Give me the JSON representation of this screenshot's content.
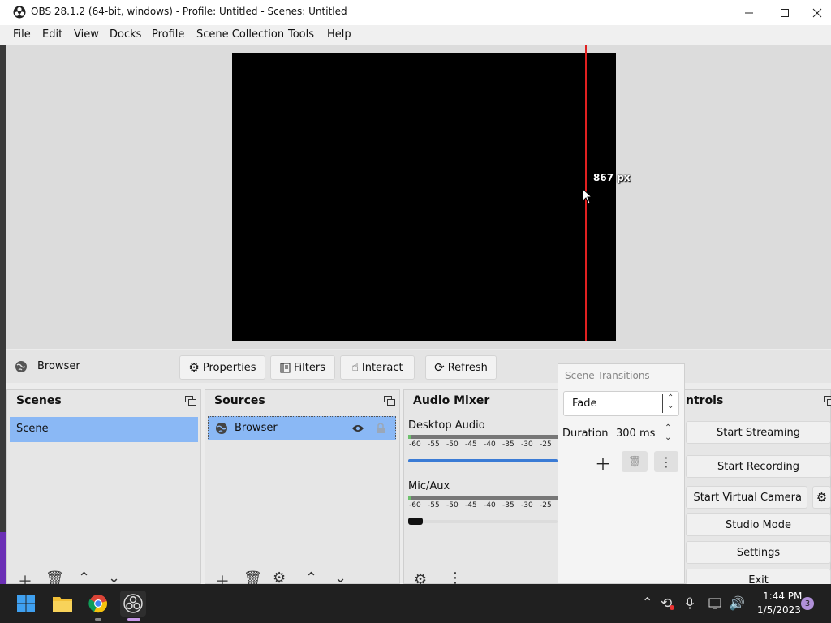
{
  "window": {
    "title": "OBS 28.1.2 (64-bit, windows) - Profile: Untitled - Scenes: Untitled"
  },
  "menu": [
    "File",
    "Edit",
    "View",
    "Docks",
    "Profile",
    "Scene Collection",
    "Tools",
    "Help"
  ],
  "preview": {
    "measure_label": "867 px"
  },
  "context_bar": {
    "source_name": "Browser",
    "properties": "Properties",
    "filters": "Filters",
    "interact": "Interact",
    "refresh": "Refresh"
  },
  "scenes": {
    "title": "Scenes",
    "items": [
      "Scene"
    ]
  },
  "sources": {
    "title": "Sources",
    "items": [
      "Browser"
    ]
  },
  "audio_mixer": {
    "title": "Audio Mixer",
    "channels": [
      {
        "name": "Desktop Audio",
        "scale": [
          "-60",
          "-55",
          "-50",
          "-45",
          "-40",
          "-35",
          "-30",
          "-25"
        ],
        "volume": 1.0
      },
      {
        "name": "Mic/Aux",
        "scale": [
          "-60",
          "-55",
          "-50",
          "-45",
          "-40",
          "-35",
          "-30",
          "-25"
        ],
        "volume": 0.0
      }
    ]
  },
  "scene_transitions": {
    "title": "Scene Transitions",
    "selected": "Fade",
    "duration_label": "Duration",
    "duration_value": "300 ms"
  },
  "controls": {
    "title": "ntrols",
    "start_streaming": "Start Streaming",
    "start_recording": "Start Recording",
    "start_virtual_camera": "Start Virtual Camera",
    "studio_mode": "Studio Mode",
    "settings": "Settings",
    "exit": "Exit"
  },
  "taskbar": {
    "time": "1:44 PM",
    "date": "1/5/2023",
    "notifications": "3"
  },
  "colors": {
    "selection": "#8ab8f5",
    "red_guide": "#e02020",
    "volume_bar": "#3a7bd5"
  }
}
